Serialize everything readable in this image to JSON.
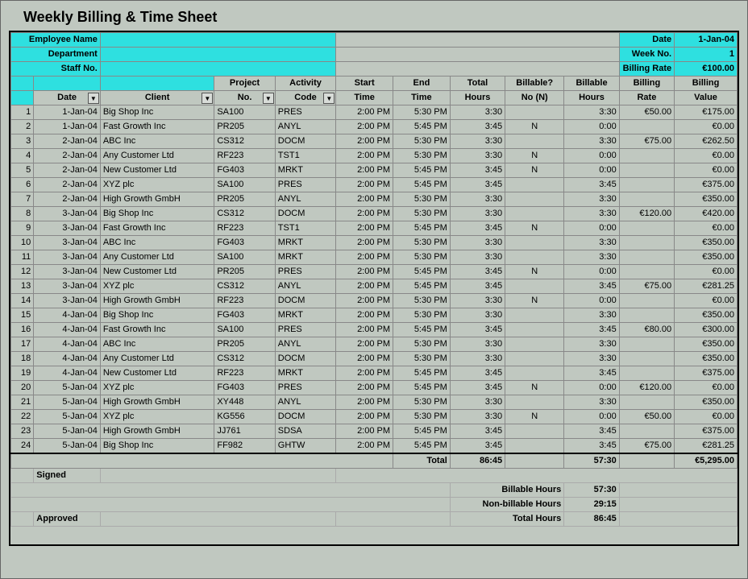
{
  "title": "Weekly Billing & Time Sheet",
  "headerLabels": {
    "emp": "Employee Name",
    "dept": "Department",
    "staff": "Staff No.",
    "date": "Date",
    "week": "Week No.",
    "rate": "Billing Rate"
  },
  "headerValues": {
    "date": "1-Jan-04",
    "week": "1",
    "rate": "€100.00"
  },
  "cols": {
    "num": "",
    "date": "Date",
    "client": "Client",
    "proj1": "Project",
    "proj2": "No.",
    "act1": "Activity",
    "act2": "Code",
    "start1": "Start",
    "start2": "Time",
    "end1": "End",
    "end2": "Time",
    "th1": "Total",
    "th2": "Hours",
    "bq1": "Billable?",
    "bq2": "No (N)",
    "bh1": "Billable",
    "bh2": "Hours",
    "br1": "Billing",
    "br2": "Rate",
    "bv1": "Billing",
    "bv2": "Value"
  },
  "rows": [
    {
      "n": "1",
      "d": "1-Jan-04",
      "cl": "Big Shop Inc",
      "p": "SA100",
      "a": "PRES",
      "s": "2:00 PM",
      "e": "5:30 PM",
      "th": "3:30",
      "bq": "",
      "bh": "3:30",
      "br": "€50.00",
      "bv": "€175.00"
    },
    {
      "n": "2",
      "d": "1-Jan-04",
      "cl": "Fast Growth Inc",
      "p": "PR205",
      "a": "ANYL",
      "s": "2:00 PM",
      "e": "5:45 PM",
      "th": "3:45",
      "bq": "N",
      "bh": "0:00",
      "br": "",
      "bv": "€0.00"
    },
    {
      "n": "3",
      "d": "2-Jan-04",
      "cl": "ABC Inc",
      "p": "CS312",
      "a": "DOCM",
      "s": "2:00 PM",
      "e": "5:30 PM",
      "th": "3:30",
      "bq": "",
      "bh": "3:30",
      "br": "€75.00",
      "bv": "€262.50"
    },
    {
      "n": "4",
      "d": "2-Jan-04",
      "cl": "Any Customer Ltd",
      "p": "RF223",
      "a": "TST1",
      "s": "2:00 PM",
      "e": "5:30 PM",
      "th": "3:30",
      "bq": "N",
      "bh": "0:00",
      "br": "",
      "bv": "€0.00"
    },
    {
      "n": "5",
      "d": "2-Jan-04",
      "cl": "New Customer Ltd",
      "p": "FG403",
      "a": "MRKT",
      "s": "2:00 PM",
      "e": "5:45 PM",
      "th": "3:45",
      "bq": "N",
      "bh": "0:00",
      "br": "",
      "bv": "€0.00"
    },
    {
      "n": "6",
      "d": "2-Jan-04",
      "cl": "XYZ plc",
      "p": "SA100",
      "a": "PRES",
      "s": "2:00 PM",
      "e": "5:45 PM",
      "th": "3:45",
      "bq": "",
      "bh": "3:45",
      "br": "",
      "bv": "€375.00"
    },
    {
      "n": "7",
      "d": "2-Jan-04",
      "cl": "High Growth GmbH",
      "p": "PR205",
      "a": "ANYL",
      "s": "2:00 PM",
      "e": "5:30 PM",
      "th": "3:30",
      "bq": "",
      "bh": "3:30",
      "br": "",
      "bv": "€350.00"
    },
    {
      "n": "8",
      "d": "3-Jan-04",
      "cl": "Big Shop Inc",
      "p": "CS312",
      "a": "DOCM",
      "s": "2:00 PM",
      "e": "5:30 PM",
      "th": "3:30",
      "bq": "",
      "bh": "3:30",
      "br": "€120.00",
      "bv": "€420.00"
    },
    {
      "n": "9",
      "d": "3-Jan-04",
      "cl": "Fast Growth Inc",
      "p": "RF223",
      "a": "TST1",
      "s": "2:00 PM",
      "e": "5:45 PM",
      "th": "3:45",
      "bq": "N",
      "bh": "0:00",
      "br": "",
      "bv": "€0.00"
    },
    {
      "n": "10",
      "d": "3-Jan-04",
      "cl": "ABC Inc",
      "p": "FG403",
      "a": "MRKT",
      "s": "2:00 PM",
      "e": "5:30 PM",
      "th": "3:30",
      "bq": "",
      "bh": "3:30",
      "br": "",
      "bv": "€350.00"
    },
    {
      "n": "11",
      "d": "3-Jan-04",
      "cl": "Any Customer Ltd",
      "p": "SA100",
      "a": "MRKT",
      "s": "2:00 PM",
      "e": "5:30 PM",
      "th": "3:30",
      "bq": "",
      "bh": "3:30",
      "br": "",
      "bv": "€350.00"
    },
    {
      "n": "12",
      "d": "3-Jan-04",
      "cl": "New Customer Ltd",
      "p": "PR205",
      "a": "PRES",
      "s": "2:00 PM",
      "e": "5:45 PM",
      "th": "3:45",
      "bq": "N",
      "bh": "0:00",
      "br": "",
      "bv": "€0.00"
    },
    {
      "n": "13",
      "d": "3-Jan-04",
      "cl": "XYZ plc",
      "p": "CS312",
      "a": "ANYL",
      "s": "2:00 PM",
      "e": "5:45 PM",
      "th": "3:45",
      "bq": "",
      "bh": "3:45",
      "br": "€75.00",
      "bv": "€281.25"
    },
    {
      "n": "14",
      "d": "3-Jan-04",
      "cl": "High Growth GmbH",
      "p": "RF223",
      "a": "DOCM",
      "s": "2:00 PM",
      "e": "5:30 PM",
      "th": "3:30",
      "bq": "N",
      "bh": "0:00",
      "br": "",
      "bv": "€0.00"
    },
    {
      "n": "15",
      "d": "4-Jan-04",
      "cl": "Big Shop Inc",
      "p": "FG403",
      "a": "MRKT",
      "s": "2:00 PM",
      "e": "5:30 PM",
      "th": "3:30",
      "bq": "",
      "bh": "3:30",
      "br": "",
      "bv": "€350.00"
    },
    {
      "n": "16",
      "d": "4-Jan-04",
      "cl": "Fast Growth Inc",
      "p": "SA100",
      "a": "PRES",
      "s": "2:00 PM",
      "e": "5:45 PM",
      "th": "3:45",
      "bq": "",
      "bh": "3:45",
      "br": "€80.00",
      "bv": "€300.00"
    },
    {
      "n": "17",
      "d": "4-Jan-04",
      "cl": "ABC Inc",
      "p": "PR205",
      "a": "ANYL",
      "s": "2:00 PM",
      "e": "5:30 PM",
      "th": "3:30",
      "bq": "",
      "bh": "3:30",
      "br": "",
      "bv": "€350.00"
    },
    {
      "n": "18",
      "d": "4-Jan-04",
      "cl": "Any Customer Ltd",
      "p": "CS312",
      "a": "DOCM",
      "s": "2:00 PM",
      "e": "5:30 PM",
      "th": "3:30",
      "bq": "",
      "bh": "3:30",
      "br": "",
      "bv": "€350.00"
    },
    {
      "n": "19",
      "d": "4-Jan-04",
      "cl": "New Customer Ltd",
      "p": "RF223",
      "a": "MRKT",
      "s": "2:00 PM",
      "e": "5:45 PM",
      "th": "3:45",
      "bq": "",
      "bh": "3:45",
      "br": "",
      "bv": "€375.00"
    },
    {
      "n": "20",
      "d": "5-Jan-04",
      "cl": "XYZ plc",
      "p": "FG403",
      "a": "PRES",
      "s": "2:00 PM",
      "e": "5:45 PM",
      "th": "3:45",
      "bq": "N",
      "bh": "0:00",
      "br": "€120.00",
      "bv": "€0.00"
    },
    {
      "n": "21",
      "d": "5-Jan-04",
      "cl": "High Growth GmbH",
      "p": "XY448",
      "a": "ANYL",
      "s": "2:00 PM",
      "e": "5:30 PM",
      "th": "3:30",
      "bq": "",
      "bh": "3:30",
      "br": "",
      "bv": "€350.00"
    },
    {
      "n": "22",
      "d": "5-Jan-04",
      "cl": "XYZ plc",
      "p": "KG556",
      "a": "DOCM",
      "s": "2:00 PM",
      "e": "5:30 PM",
      "th": "3:30",
      "bq": "N",
      "bh": "0:00",
      "br": "€50.00",
      "bv": "€0.00"
    },
    {
      "n": "23",
      "d": "5-Jan-04",
      "cl": "High Growth GmbH",
      "p": "JJ761",
      "a": "SDSA",
      "s": "2:00 PM",
      "e": "5:45 PM",
      "th": "3:45",
      "bq": "",
      "bh": "3:45",
      "br": "",
      "bv": "€375.00"
    },
    {
      "n": "24",
      "d": "5-Jan-04",
      "cl": "Big Shop Inc",
      "p": "FF982",
      "a": "GHTW",
      "s": "2:00 PM",
      "e": "5:45 PM",
      "th": "3:45",
      "bq": "",
      "bh": "3:45",
      "br": "€75.00",
      "bv": "€281.25"
    }
  ],
  "totals": {
    "label": "Total",
    "th": "86:45",
    "bh": "57:30",
    "bv": "€5,295.00"
  },
  "sig": {
    "signed": "Signed",
    "approved": "Approved"
  },
  "summary": {
    "bhLab": "Billable Hours",
    "bh": "57:30",
    "nbLab": "Non-billable Hours",
    "nb": "29:15",
    "thLab": "Total Hours",
    "th": "86:45"
  }
}
